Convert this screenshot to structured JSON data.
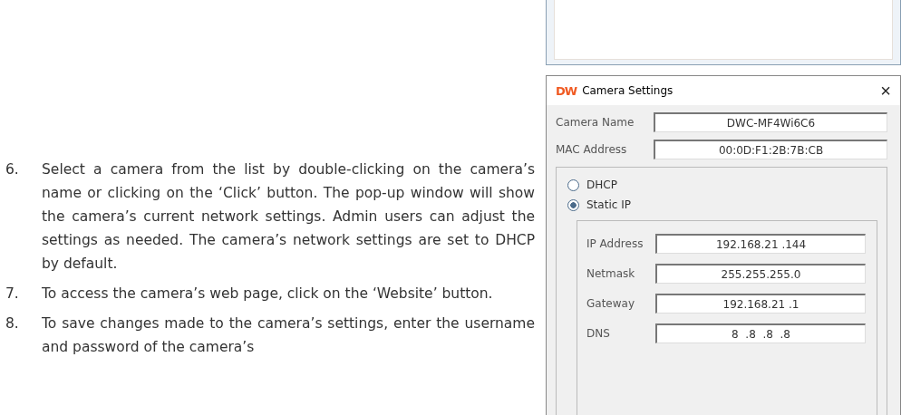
{
  "steps": [
    {
      "number": "6.",
      "text": "Select a camera from the list by double-clicking on the camera’s name or clicking on the ‘Click’ button. The pop-up window will show the camera’s current network settings. Admin users can adjust the settings as needed. The camera’s network settings are set to DHCP by default."
    },
    {
      "number": "7.",
      "text": "To access the camera’s web page, click on the ‘Website’ button."
    },
    {
      "number": "8.",
      "text": "To save changes made to the camera’s settings, enter the username and password of the camera’s"
    }
  ],
  "dialog": {
    "logo": "DW",
    "title": "Camera Settings",
    "close": "×",
    "fields": [
      {
        "label": "Camera Name",
        "value": "DWC-MF4Wi6C6"
      },
      {
        "label": "MAC Address",
        "value": "00:0D:F1:2B:7B:CB"
      }
    ],
    "modes": [
      {
        "label": "DHCP",
        "selected": false
      },
      {
        "label": "Static IP",
        "selected": true
      }
    ],
    "ip_fields": [
      {
        "label": "IP Address",
        "value": "192.168.21 .144"
      },
      {
        "label": "Netmask",
        "value": "255.255.255.0"
      },
      {
        "label": "Gateway",
        "value": "192.168.21 .1"
      },
      {
        "label": "DNS",
        "value": "8  .8  .8  .8"
      }
    ]
  }
}
